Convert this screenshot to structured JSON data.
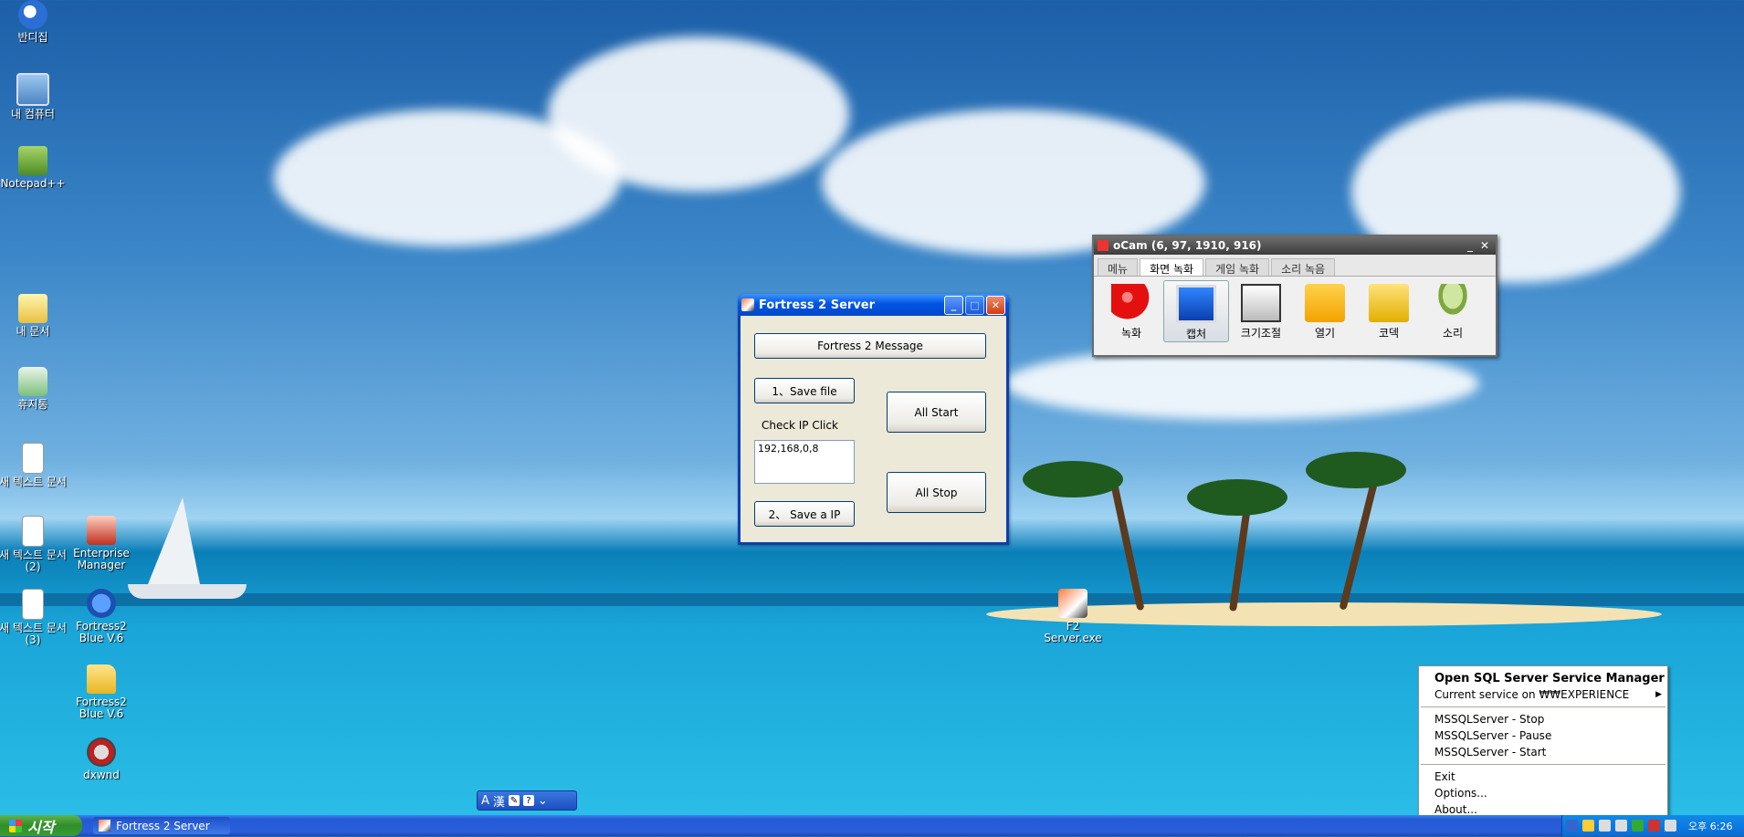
{
  "desktop": {
    "icons": [
      {
        "label": "반디집",
        "icon": "bandizip-icon"
      },
      {
        "label": "내 컴퓨터",
        "icon": "my-computer-icon"
      },
      {
        "label": "Notepad++",
        "icon": "notepad-plus-plus-icon"
      },
      {
        "label": "내 문서",
        "icon": "my-documents-icon"
      },
      {
        "label": "휴지통",
        "icon": "recycle-bin-icon"
      },
      {
        "label": "새 텍스트 문서",
        "icon": "text-document-icon"
      },
      {
        "label": "새 텍스트 문서 (2)",
        "icon": "text-document-icon"
      },
      {
        "label": "새 텍스트 문서 (3)",
        "icon": "text-document-icon"
      },
      {
        "label": "Enterprise Manager",
        "icon": "enterprise-manager-icon"
      },
      {
        "label": "Fortress2 Blue V.6",
        "icon": "zip-archive-icon"
      },
      {
        "label": "Fortress2 Blue V.6",
        "icon": "folder-icon"
      },
      {
        "label": "dxwnd",
        "icon": "dxwnd-icon"
      },
      {
        "label": "F2 Server.exe",
        "icon": "f2-server-icon"
      }
    ]
  },
  "fortress_window": {
    "title": "Fortress 2 Server",
    "message_button": "Fortress 2 Message",
    "save_file_button": "1、Save file",
    "check_ip_label": "Check IP Click",
    "ip_value": "192,168,0,8",
    "save_ip_button": "2、 Save a IP",
    "all_start_button": "All Start",
    "all_stop_button": "All Stop"
  },
  "ocam": {
    "title": "oCam (6, 97, 1910, 916)",
    "tabs": [
      "메뉴",
      "화면 녹화",
      "게임 녹화",
      "소리 녹음"
    ],
    "active_tab": "화면 녹화",
    "tools": [
      {
        "label": "녹화",
        "icon": "record-icon"
      },
      {
        "label": "캡처",
        "icon": "capture-icon"
      },
      {
        "label": "크기조절",
        "icon": "resize-icon"
      },
      {
        "label": "열기",
        "icon": "open-folder-icon"
      },
      {
        "label": "코덱",
        "icon": "codec-icon"
      },
      {
        "label": "소리",
        "icon": "microphone-icon"
      }
    ]
  },
  "context_menu": {
    "items": [
      {
        "label": "Open SQL Server Service Manager"
      },
      {
        "label": "Current service on ₩₩EXPERIENCE"
      },
      {
        "label": "MSSQLServer - Stop"
      },
      {
        "label": "MSSQLServer - Pause"
      },
      {
        "label": "MSSQLServer - Start"
      },
      {
        "label": "Exit"
      },
      {
        "label": "Options..."
      },
      {
        "label": "About..."
      }
    ]
  },
  "taskbar": {
    "start_label": "시작",
    "task_label": "Fortress 2 Server",
    "clock": "오후 6:26"
  },
  "langbar": {
    "mode": "A",
    "hanja": "漢"
  }
}
